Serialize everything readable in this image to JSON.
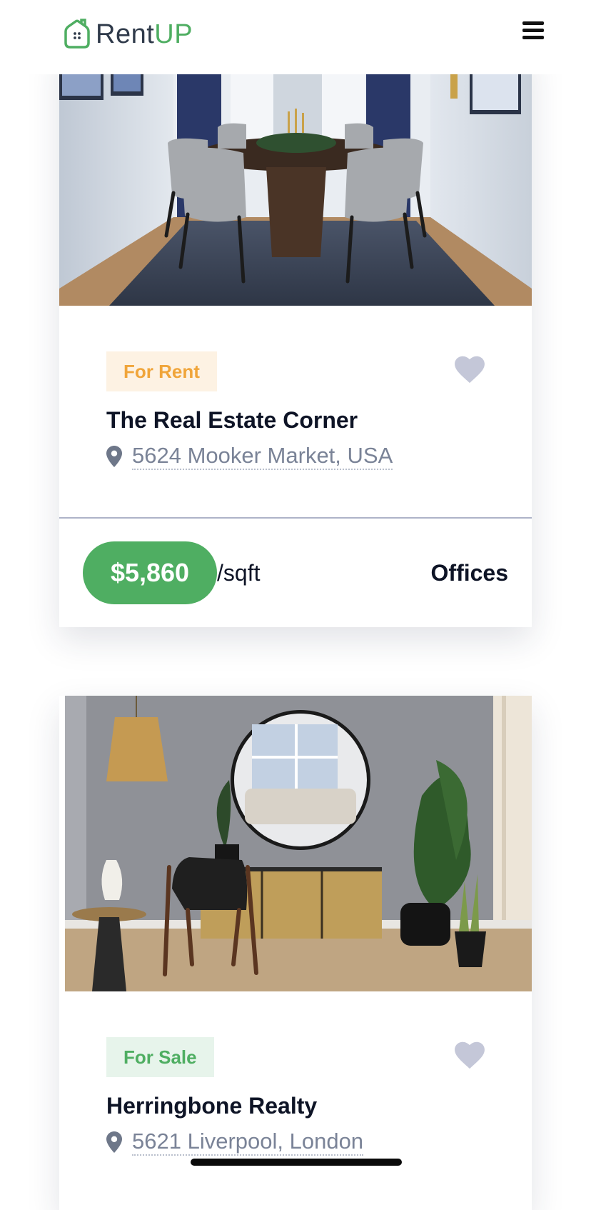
{
  "header": {
    "logo_icon": "house-icon",
    "logo_rent": "Rent",
    "logo_up": "UP",
    "menu_icon": "hamburger-menu-icon"
  },
  "colors": {
    "brand_green": "#4fae62",
    "rent_badge_text": "#f0a53a",
    "heart_gray": "#c4c7d8"
  },
  "listings": [
    {
      "image": "dining-room-photo",
      "status": "For Rent",
      "favorite_icon": "heart-icon",
      "title": "The Real Estate Corner",
      "location_icon": "map-pin-icon",
      "address": "5624 Mooker Market, USA",
      "price": "$5,860",
      "unit": "/sqft",
      "type": "Offices"
    },
    {
      "image": "living-room-photo",
      "status": "For Sale",
      "favorite_icon": "heart-icon",
      "title": "Herringbone Realty",
      "location_icon": "map-pin-icon",
      "address": "5621 Liverpool, London"
    }
  ]
}
